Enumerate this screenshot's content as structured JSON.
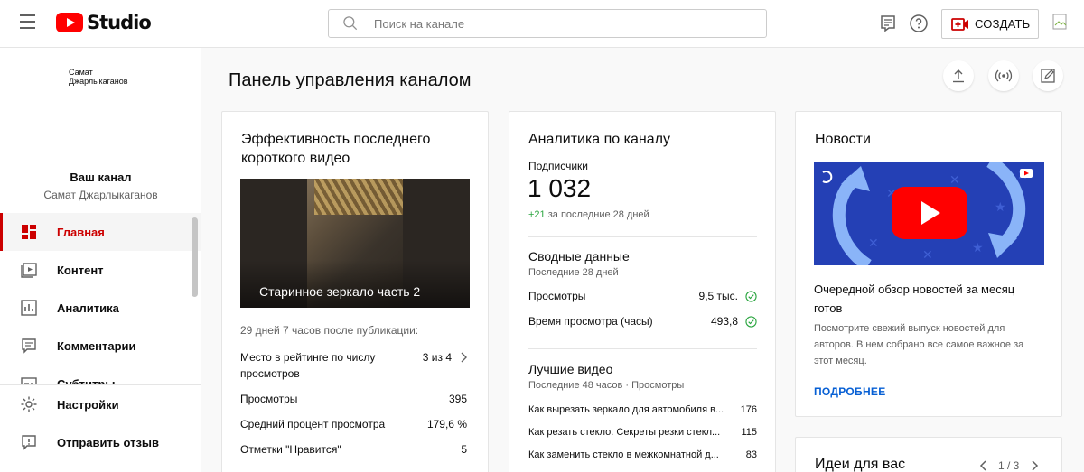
{
  "header": {
    "logo_text": "Studio",
    "search_placeholder": "Поиск на канале",
    "create_label": "СОЗДАТЬ"
  },
  "sidebar": {
    "avatar_alt_lines": [
      "Самат",
      "Джарлыкаганов"
    ],
    "your_channel": "Ваш канал",
    "channel_name": "Самат Джарлыкаганов",
    "items": [
      {
        "label": "Главная",
        "icon": "dashboard-icon",
        "active": true
      },
      {
        "label": "Контент",
        "icon": "content-icon"
      },
      {
        "label": "Аналитика",
        "icon": "analytics-icon"
      },
      {
        "label": "Комментарии",
        "icon": "comments-icon"
      },
      {
        "label": "Субтитры",
        "icon": "subtitles-icon"
      }
    ],
    "bottom_items": [
      {
        "label": "Настройки",
        "icon": "gear-icon"
      },
      {
        "label": "Отправить отзыв",
        "icon": "feedback-icon"
      }
    ]
  },
  "main": {
    "page_title": "Панель управления каналом"
  },
  "card_short": {
    "title": "Эффективность последнего короткого видео",
    "video_title": "Старинное зеркало часть 2",
    "since_publish": "29 дней 7 часов после публикации:",
    "rows": [
      {
        "label": "Место в рейтинге по числу просмотров",
        "value": "3 из 4"
      },
      {
        "label": "Просмотры",
        "value": "395"
      },
      {
        "label": "Средний процент просмотра",
        "value": "179,6 %"
      },
      {
        "label": "Отметки \"Нравится\"",
        "value": "5"
      }
    ]
  },
  "card_analytics": {
    "title": "Аналитика по каналу",
    "subs_label": "Подписчики",
    "subs_value": "1 032",
    "subs_delta": "+21",
    "subs_delta_period": "за последние 28 дней",
    "summary_title": "Сводные данные",
    "summary_period": "Последние 28 дней",
    "stats": [
      {
        "label": "Просмотры",
        "value": "9,5 тыс."
      },
      {
        "label": "Время просмотра (часы)",
        "value": "493,8"
      }
    ],
    "top_title": "Лучшие видео",
    "top_period": "Последние 48 часов · Просмотры",
    "videos": [
      {
        "title": "Как вырезать зеркало для автомобиля в...",
        "value": "176"
      },
      {
        "title": "Как резать стекло. Секреты резки стекл...",
        "value": "115"
      },
      {
        "title": "Как заменить стекло в межкомнатной д...",
        "value": "83"
      }
    ]
  },
  "card_news": {
    "title": "Новости",
    "news_title": "Очередной обзор новостей за месяц готов",
    "news_body": "Посмотрите свежий выпуск новостей для авторов. В нем собрано все самое важное за этот месяц.",
    "link": "ПОДРОБНЕЕ"
  },
  "card_ideas": {
    "title": "Идеи для вас",
    "pager": "1 / 3"
  },
  "colors": {
    "accent_red": "#cc0000",
    "link_blue": "#065fd4",
    "positive_green": "#2ba640"
  }
}
